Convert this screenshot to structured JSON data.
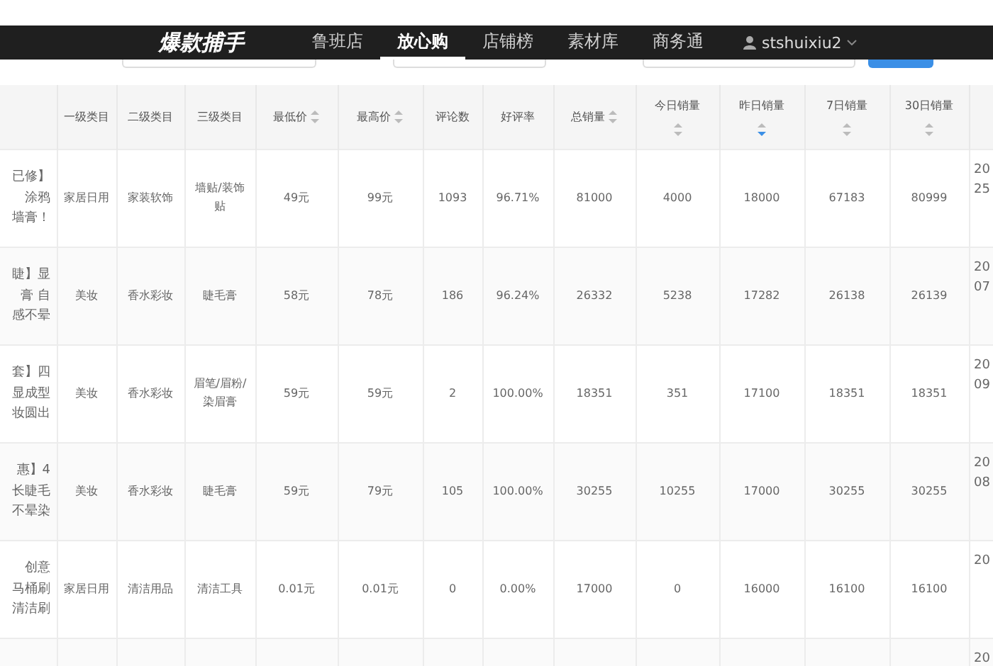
{
  "nav": {
    "logo": "爆款捕手",
    "tabs": [
      {
        "label": "鲁班店",
        "selected": false
      },
      {
        "label": "放心购",
        "selected": true
      },
      {
        "label": "店铺榜",
        "selected": false
      },
      {
        "label": "素材库",
        "selected": false
      },
      {
        "label": "商务通",
        "selected": false
      }
    ],
    "user": "stshuixiu2"
  },
  "table": {
    "columns": [
      {},
      {
        "label": "一级类目"
      },
      {
        "label": "二级类目"
      },
      {
        "label": "三级类目"
      },
      {
        "label": "最低价",
        "sorted": false
      },
      {
        "label": "最高价",
        "sorted": false
      },
      {
        "label": "评论数"
      },
      {
        "label": "好评率"
      },
      {
        "label": "总销量",
        "sorted": false
      },
      {
        "label": "今日销量",
        "sorted": false
      },
      {
        "label": "昨日销量",
        "sorted": true
      },
      {
        "label": "7日销量",
        "sorted": false
      },
      {
        "label": "30日销量",
        "sorted": false
      },
      {}
    ],
    "rows": [
      {
        "cells": [
          [
            "已修】",
            "涂鸦",
            "墙膏！"
          ],
          "家居日用",
          "家装软饰",
          "墙贴/装饰贴",
          "49元",
          "99元",
          "1093",
          "96.71%",
          "81000",
          "4000",
          "18000",
          "67183",
          "80999",
          [
            "20",
            "25"
          ]
        ]
      },
      {
        "cells": [
          [
            "睫】显",
            "膏 自",
            "感不晕"
          ],
          "美妆",
          "香水彩妆",
          "睫毛膏",
          "58元",
          "78元",
          "186",
          "96.24%",
          "26332",
          "5238",
          "17282",
          "26138",
          "26139",
          [
            "20",
            "07"
          ]
        ]
      },
      {
        "cells": [
          [
            "套】四",
            "显成型",
            "妆圆出"
          ],
          "美妆",
          "香水彩妆",
          "眉笔/眉粉/染眉膏",
          "59元",
          "59元",
          "2",
          "100.00%",
          "18351",
          "351",
          "17100",
          "18351",
          "18351",
          [
            "20",
            "09"
          ]
        ]
      },
      {
        "cells": [
          [
            "惠】4",
            "长睫毛",
            "不晕染"
          ],
          "美妆",
          "香水彩妆",
          "睫毛膏",
          "59元",
          "79元",
          "105",
          "100.00%",
          "30255",
          "10255",
          "17000",
          "30255",
          "30255",
          [
            "20",
            "08"
          ]
        ]
      },
      {
        "cells": [
          [
            "创意",
            "马桶刷",
            "清洁刷"
          ],
          "家居日用",
          "清洁用品",
          "清洁工具",
          "0.01元",
          "0.01元",
          "0",
          "0.00%",
          "17000",
          "0",
          "16000",
          "16100",
          "16100",
          [
            "20"
          ]
        ]
      },
      {
        "cells": [
          [],
          "",
          "",
          "",
          "",
          "",
          "",
          "",
          "",
          "",
          "",
          "",
          "",
          [
            "20"
          ]
        ]
      }
    ]
  }
}
